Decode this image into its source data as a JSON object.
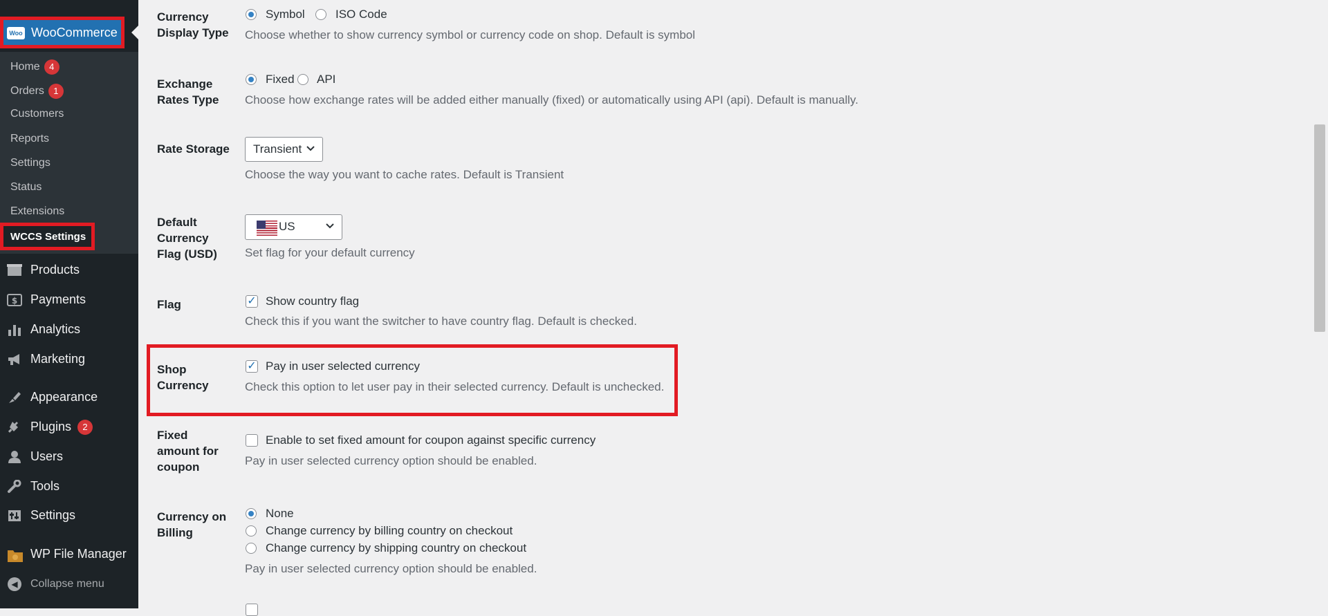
{
  "sidebar": {
    "woocommerce_label": "WooCommerce",
    "woo_logo": "Woo",
    "submenu": [
      {
        "label": "Home",
        "badge": "4"
      },
      {
        "label": "Orders",
        "badge": "1"
      },
      {
        "label": "Customers"
      },
      {
        "label": "Reports"
      },
      {
        "label": "Settings"
      },
      {
        "label": "Status"
      },
      {
        "label": "Extensions"
      },
      {
        "label": "WCCS Settings"
      }
    ],
    "menu": [
      {
        "label": "Products",
        "icon": "products-icon"
      },
      {
        "label": "Payments",
        "icon": "payments-icon"
      },
      {
        "label": "Analytics",
        "icon": "analytics-icon"
      },
      {
        "label": "Marketing",
        "icon": "marketing-icon"
      },
      {
        "label": "Appearance",
        "icon": "appearance-icon"
      },
      {
        "label": "Plugins",
        "icon": "plugins-icon",
        "badge": "2"
      },
      {
        "label": "Users",
        "icon": "users-icon"
      },
      {
        "label": "Tools",
        "icon": "tools-icon"
      },
      {
        "label": "Settings",
        "icon": "settings-icon"
      },
      {
        "label": "WP File Manager",
        "icon": "file-manager-icon"
      }
    ],
    "collapse_label": "Collapse menu"
  },
  "settings": {
    "currency_display": {
      "label": "Currency Display Type",
      "options": [
        "Symbol",
        "ISO Code"
      ],
      "selected": "Symbol",
      "description": "Choose whether to show currency symbol or currency code on shop. Default is symbol"
    },
    "exchange_rates": {
      "label": "Exchange Rates Type",
      "options": [
        "Fixed",
        "API"
      ],
      "selected": "Fixed",
      "description": "Choose how exchange rates will be added either manually (fixed) or automatically using API (api). Default is manually."
    },
    "rate_storage": {
      "label": "Rate Storage",
      "value": "Transient",
      "description": "Choose the way you want to cache rates. Default is Transient"
    },
    "default_flag": {
      "label": "Default Currency Flag (USD)",
      "value": "US",
      "description": "Set flag for your default currency"
    },
    "flag": {
      "label": "Flag",
      "checkbox_label": "Show country flag",
      "checked": true,
      "description": "Check this if you want the switcher to have country flag. Default is checked."
    },
    "shop_currency": {
      "label": "Shop Currency",
      "checkbox_label": "Pay in user selected currency",
      "checked": true,
      "description": "Check this option to let user pay in their selected currency. Default is unchecked."
    },
    "fixed_coupon": {
      "label": "Fixed amount for coupon",
      "checkbox_label": "Enable to set fixed amount for coupon against specific currency",
      "checked": false,
      "description": "Pay in user selected currency option should be enabled."
    },
    "billing": {
      "label": "Currency on Billing",
      "options": [
        "None",
        "Change currency by billing country on checkout",
        "Change currency by shipping country on checkout"
      ],
      "selected": "None",
      "description": "Pay in user selected currency option should be enabled."
    }
  },
  "colors": {
    "accent": "#2271b1",
    "highlight": "#e21b23",
    "badge": "#d63638"
  }
}
